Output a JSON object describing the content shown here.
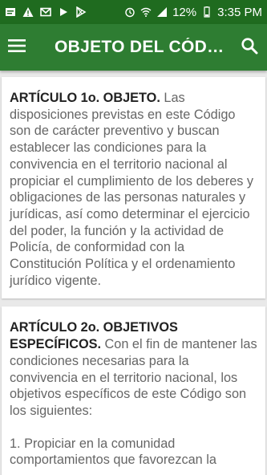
{
  "status_bar": {
    "left_icons": [
      "notification-icon",
      "warning-icon",
      "gmail-icon",
      "play-icon",
      "play-store-icon"
    ],
    "right_icons": [
      "alarm-icon",
      "wifi-icon",
      "signal-icon",
      "battery-icon"
    ],
    "battery_percent": "12%",
    "time": "3:35 PM"
  },
  "app_bar": {
    "title": "OBJETO DEL CÓDIGO",
    "menu_icon": "menu-icon",
    "search_icon": "search-icon"
  },
  "articles": [
    {
      "heading": "ARTÍCULO 1o. OBJETO.",
      "body": " Las disposiciones previstas en este Código son de carácter preventivo y buscan establecer las condiciones para la convivencia en el territorio nacional al propiciar el cumplimiento de los deberes y obligaciones de las personas naturales y jurídicas, así como determinar el ejercicio del poder, la función y la actividad de Policía, de conformidad con la Constitución Política y el ordenamiento jurídico vigente."
    },
    {
      "heading": "ARTÍCULO 2o. OBJETIVOS ESPECÍFICOS.",
      "body": " Con el fin de mantener las condiciones necesarias para la convivencia en el territorio nacional, los objetivos específicos de este Código son los siguientes:",
      "item": "1. Propiciar en la comunidad comportamientos que favorezcan la"
    }
  ]
}
